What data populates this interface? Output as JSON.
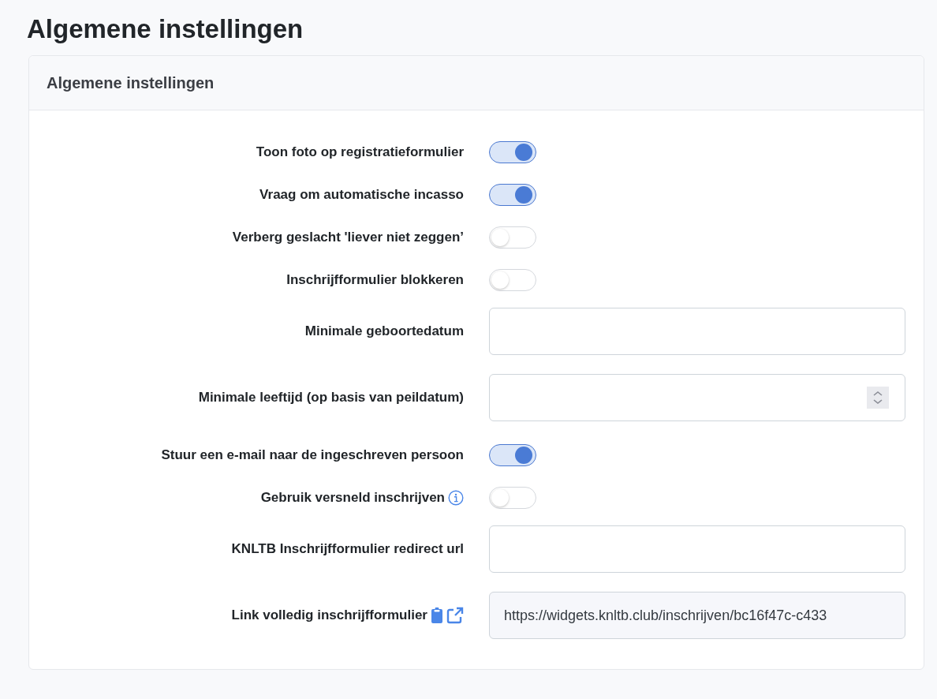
{
  "page_title": "Algemene instellingen",
  "card": {
    "title": "Algemene instellingen",
    "rows": [
      {
        "kind": "toggle",
        "label": "Toon foto op registratieformulier",
        "on": true
      },
      {
        "kind": "toggle",
        "label": "Vraag om automatische incasso",
        "on": true
      },
      {
        "kind": "toggle",
        "label": "Verberg geslacht 'liever niet zeggen’",
        "on": false
      },
      {
        "kind": "toggle",
        "label": "Inschrijfformulier blokkeren",
        "on": false
      },
      {
        "kind": "date",
        "label": "Minimale geboortedatum"
      },
      {
        "kind": "number",
        "label": "Minimale leeftijd (op basis van peildatum)"
      },
      {
        "kind": "toggle",
        "label": "Stuur een e-mail naar de ingeschreven persoon",
        "on": true
      },
      {
        "kind": "toggle",
        "label": "Gebruik versneld inschrijven",
        "on": false,
        "info": true
      },
      {
        "kind": "text",
        "label": "KNLTB Inschrijfformulier redirect url"
      },
      {
        "kind": "link",
        "label": "Link volledig inschrijfformulier",
        "value": "https://widgets.knltb.club/inschrijven/bc16f47c-c433"
      }
    ]
  }
}
